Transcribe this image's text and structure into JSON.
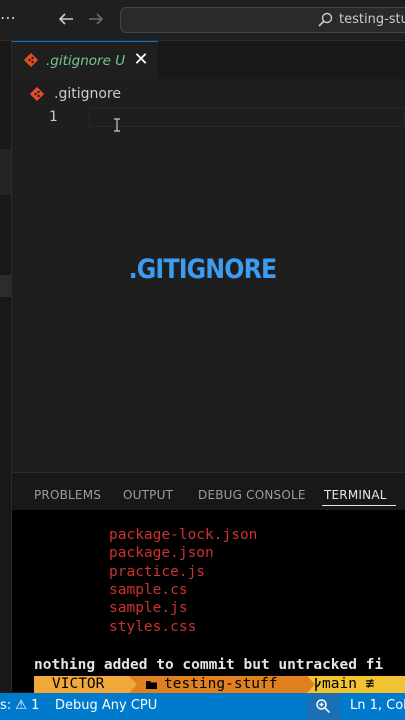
{
  "titlebar": {
    "menu_icon": "more-dots-icon",
    "search_text": "testing-stuf"
  },
  "tab": {
    "label": ".gitignore",
    "status": "U",
    "close": "✕"
  },
  "breadcrumb": {
    "label": ".gitignore"
  },
  "editor": {
    "line_number": "1",
    "overlay_title": ".GITIGNORE",
    "overlay_color": "#3b9cf2"
  },
  "panel": {
    "tabs": [
      "PROBLEMS",
      "OUTPUT",
      "DEBUG CONSOLE",
      "TERMINAL"
    ],
    "active_tab": "TERMINAL"
  },
  "terminal": {
    "untracked_files": [
      "package-lock.json",
      "package.json",
      "practice.js",
      "sample.cs",
      "sample.js",
      "styles.css"
    ],
    "message": "nothing added to commit but untracked fi",
    "prompt_user": "VICTOR",
    "prompt_dir": "testing-stuff",
    "prompt_branch": "main ≢"
  },
  "statusbar": {
    "warnings": "s: ⚠ 1",
    "debug": "Debug Any CPU",
    "position": "Ln 1, Col"
  },
  "colors": {
    "accent": "#007acc",
    "untracked": "#73c991",
    "terminal_red": "#cd3131"
  }
}
